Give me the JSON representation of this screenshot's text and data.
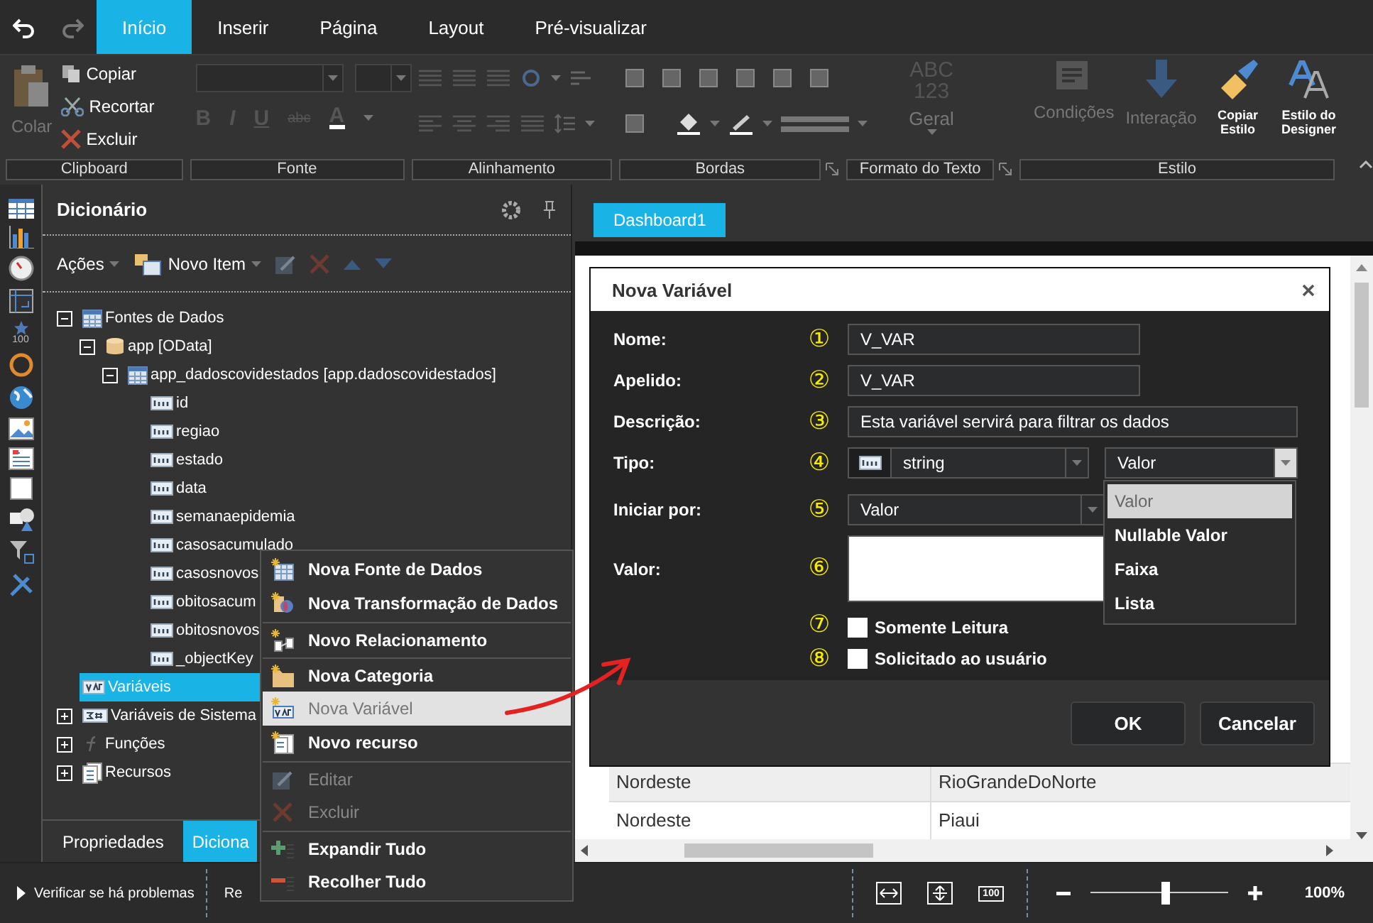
{
  "ribbon_tabs": [
    {
      "label": "Início",
      "selected": true
    },
    {
      "label": "Inserir",
      "selected": false
    },
    {
      "label": "Página",
      "selected": false
    },
    {
      "label": "Layout",
      "selected": false
    },
    {
      "label": "Pré-visualizar",
      "selected": false
    }
  ],
  "ribbon": {
    "paste": {
      "label": "Colar",
      "disabled": true
    },
    "clipboard_actions": [
      {
        "kind": "copy",
        "label": "Copiar",
        "disabled": false
      },
      {
        "kind": "cut",
        "label": "Recortar",
        "disabled": false
      },
      {
        "kind": "delete",
        "label": "Excluir",
        "disabled": false
      }
    ],
    "font_buttons": [
      {
        "kind": "bold",
        "label": "B"
      },
      {
        "kind": "italic",
        "label": "I"
      },
      {
        "kind": "underline",
        "label": "U"
      },
      {
        "kind": "strike",
        "label": "abc"
      },
      {
        "kind": "color",
        "label": "A"
      }
    ],
    "format_sample": [
      "ABC",
      "123"
    ],
    "format": "Geral",
    "style_buttons": [
      {
        "kind": "conditions",
        "label": "Condições",
        "disabled": true
      },
      {
        "kind": "interaction",
        "label": "Interação",
        "disabled": true
      },
      {
        "kind": "copy_style",
        "label": "Copiar Estilo",
        "disabled": false
      },
      {
        "kind": "designer_style",
        "label": "Estilo do Designer",
        "disabled": false
      }
    ]
  },
  "ribbon_groups": [
    {
      "label": "Clipboard",
      "launcher": false
    },
    {
      "label": "Fonte",
      "launcher": false
    },
    {
      "label": "Alinhamento",
      "launcher": false
    },
    {
      "label": "Bordas",
      "launcher": true
    },
    {
      "label": "Formato do Texto",
      "launcher": true
    },
    {
      "label": "Estilo",
      "launcher": false
    }
  ],
  "toolbox": {
    "indicator_value": "100"
  },
  "dictionary": {
    "title": "Dicionário",
    "actions": "Ações",
    "new_item": "Novo Item",
    "tree": [
      {
        "kind": "table",
        "label": "Fontes de Dados",
        "expanded": true,
        "selected": false,
        "children": [
          {
            "kind": "database",
            "label": "app [OData]",
            "expanded": true,
            "selected": false,
            "children": [
              {
                "kind": "table",
                "label": "app_dadoscovidestados [app.dadoscovidestados]",
                "expanded": true,
                "selected": false,
                "children": [
                  {
                    "kind": "field",
                    "label": "id",
                    "selected": false
                  },
                  {
                    "kind": "field",
                    "label": "regiao",
                    "selected": false
                  },
                  {
                    "kind": "field",
                    "label": "estado",
                    "selected": false
                  },
                  {
                    "kind": "field",
                    "label": "data",
                    "selected": false
                  },
                  {
                    "kind": "field",
                    "label": "semanaepidemia",
                    "selected": false
                  },
                  {
                    "kind": "field",
                    "label": "casosacumulado",
                    "selected": false
                  },
                  {
                    "kind": "field",
                    "label": "casosnovos",
                    "selected": false
                  },
                  {
                    "kind": "field",
                    "label": "obitosacum",
                    "selected": false
                  },
                  {
                    "kind": "field",
                    "label": "obitosnovos",
                    "selected": false
                  },
                  {
                    "kind": "field",
                    "label": "_objectKey",
                    "selected": false
                  }
                ]
              }
            ]
          }
        ]
      },
      {
        "kind": "variable",
        "label": "Variáveis",
        "selected": true
      },
      {
        "kind": "system",
        "label": "Variáveis de Sistema",
        "expanded": false,
        "selected": false
      },
      {
        "kind": "function",
        "label": "Funções",
        "expanded": false,
        "selected": false
      },
      {
        "kind": "resources",
        "label": "Recursos",
        "expanded": false,
        "selected": false
      }
    ],
    "tabs": [
      {
        "label": "Propriedades",
        "selected": false
      },
      {
        "label": "Diciona",
        "selected": true
      }
    ]
  },
  "document_tabs": [
    {
      "label": "Dashboard1",
      "selected": true
    }
  ],
  "table": {
    "rows": [
      {
        "cells": [
          "Nordeste",
          "RioGrandeDoNorte"
        ],
        "striped": true
      },
      {
        "cells": [
          "Nordeste",
          "Piaui"
        ],
        "striped": false
      }
    ]
  },
  "dialog": {
    "title": "Nova Variável",
    "fields": [
      {
        "kind": "text",
        "marker": "①",
        "label": "Nome:",
        "value": "V_VAR"
      },
      {
        "kind": "text",
        "marker": "②",
        "label": "Apelido:",
        "value": "V_VAR"
      },
      {
        "kind": "wide",
        "marker": "③",
        "label": "Descrição:",
        "value": "Esta variável servirá para filtrar os dados"
      },
      {
        "kind": "type",
        "marker": "④",
        "label": "Tipo:",
        "value": "string",
        "mode": "Valor",
        "open": true,
        "options": [
          {
            "label": "Valor",
            "selected": true
          },
          {
            "label": "Nullable Valor",
            "selected": false
          },
          {
            "label": "Faixa",
            "selected": false
          },
          {
            "label": "Lista",
            "selected": false
          }
        ]
      },
      {
        "kind": "select",
        "marker": "⑤",
        "label": "Iniciar por:",
        "value": "Valor"
      },
      {
        "kind": "area",
        "marker": "⑥",
        "label": "Valor:"
      },
      {
        "kind": "check",
        "marker": "⑦",
        "label": "Somente Leitura",
        "checked": false
      },
      {
        "kind": "check",
        "marker": "⑧",
        "label": "Solicitado ao usuário",
        "checked": false
      }
    ],
    "buttons": [
      "OK",
      "Cancelar"
    ]
  },
  "context_menu": [
    {
      "kind": "datasource",
      "label": "Nova Fonte de Dados",
      "separator": false,
      "disabled": false,
      "selected": false
    },
    {
      "kind": "transform",
      "label": "Nova Transformação de Dados",
      "separator": false,
      "disabled": false,
      "selected": false
    },
    {
      "kind": "relation",
      "label": "Novo Relacionamento",
      "separator": true,
      "disabled": false,
      "selected": false
    },
    {
      "kind": "category",
      "label": "Nova Categoria",
      "separator": true,
      "disabled": false,
      "selected": false
    },
    {
      "kind": "variable",
      "label": "Nova Variável",
      "separator": false,
      "disabled": false,
      "selected": true
    },
    {
      "kind": "resource",
      "label": "Novo recurso",
      "separator": false,
      "disabled": false,
      "selected": false
    },
    {
      "kind": "edit",
      "label": "Editar",
      "separator": true,
      "disabled": true,
      "selected": false
    },
    {
      "kind": "delete",
      "label": "Excluir",
      "separator": false,
      "disabled": true,
      "selected": false
    },
    {
      "kind": "expand",
      "label": "Expandir Tudo",
      "separator": true,
      "disabled": false,
      "selected": false
    },
    {
      "kind": "collapse",
      "label": "Recolher Tudo",
      "separator": false,
      "disabled": false,
      "selected": false
    }
  ],
  "status_bar": {
    "check": "Verificar se há problemas",
    "report": "Re",
    "actual_size": "100",
    "zoom_slider": {
      "level": 0.55
    },
    "zoom": "100%"
  }
}
